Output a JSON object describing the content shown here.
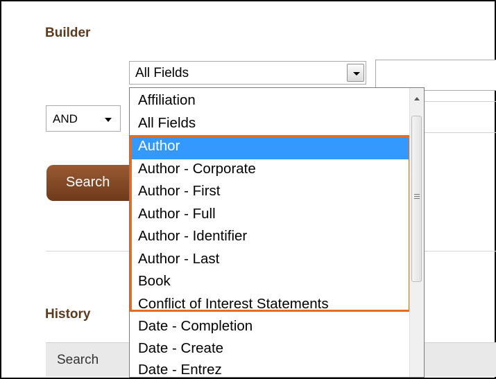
{
  "builder": {
    "title": "Builder"
  },
  "history": {
    "title": "History",
    "table_header": "Search"
  },
  "field_select": {
    "value": "All Fields"
  },
  "bool_select": {
    "value": "AND"
  },
  "search_button": {
    "label": "Search"
  },
  "dropdown": {
    "options": [
      "Affiliation",
      "All Fields",
      "Author",
      "Author - Corporate",
      "Author - First",
      "Author - Full",
      "Author - Identifier",
      "Author - Last",
      "Book",
      "Conflict of Interest Statements",
      "Date - Completion",
      "Date - Create",
      "Date - Entrez"
    ],
    "highlighted_option": "Author",
    "highlight_color": "#3399ff",
    "annotation_box_color": "#ec6a1c"
  }
}
